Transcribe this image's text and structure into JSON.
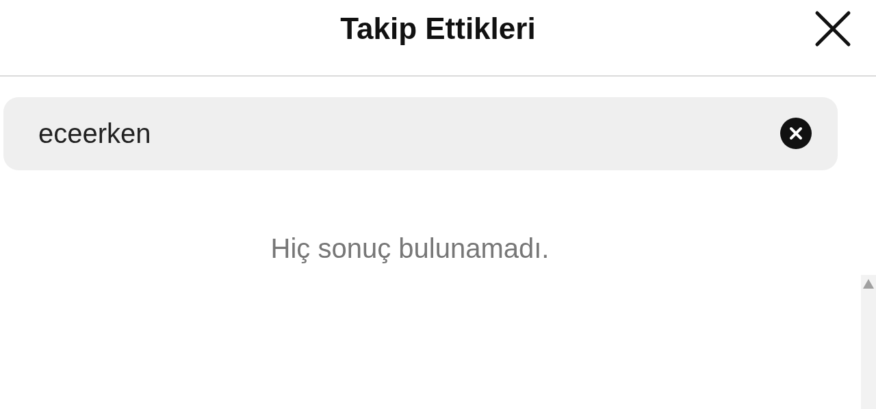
{
  "header": {
    "title": "Takip Ettikleri"
  },
  "search": {
    "value": "eceerken"
  },
  "message": "Hiç sonuç bulunamadı."
}
